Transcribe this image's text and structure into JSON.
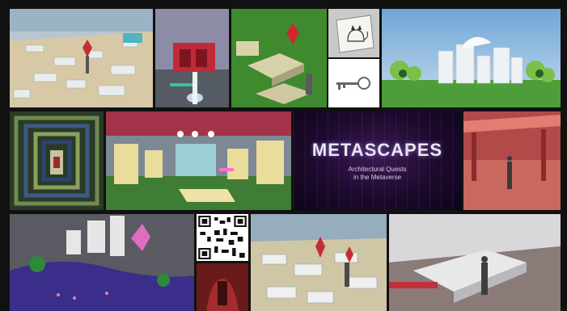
{
  "poster": {
    "title": "METASCAPES",
    "subtitle_line1": "Architectural Quests",
    "subtitle_line2": "in the Metaverse"
  },
  "tiles": [
    {
      "id": "voxel-plaza",
      "icon": "voxel-plaza-image"
    },
    {
      "id": "red-doorway",
      "icon": "red-doorway-image"
    },
    {
      "id": "green-field-crystal",
      "icon": "green-field-crystal-image"
    },
    {
      "id": "cat-drawing",
      "icon": "cat-drawing-image"
    },
    {
      "id": "key",
      "icon": "key-image"
    },
    {
      "id": "white-city",
      "icon": "white-city-image"
    },
    {
      "id": "fractal-corridor",
      "icon": "fractal-corridor-image"
    },
    {
      "id": "yellow-rooms",
      "icon": "yellow-rooms-image"
    },
    {
      "id": "red-pavilion",
      "icon": "red-pavilion-image"
    },
    {
      "id": "purple-garden",
      "icon": "purple-garden-image"
    },
    {
      "id": "qr-code",
      "icon": "qr-code-image"
    },
    {
      "id": "red-portrait",
      "icon": "red-portrait-image"
    },
    {
      "id": "crystal-plaza",
      "icon": "crystal-plaza-image"
    },
    {
      "id": "grey-ruins",
      "icon": "grey-ruins-image"
    }
  ],
  "colors": {
    "frame": "#111111",
    "title_glow": "#be8cff",
    "accent_red": "#c8323a",
    "grass": "#3e8a2e",
    "sky": "#8ab6d8"
  }
}
